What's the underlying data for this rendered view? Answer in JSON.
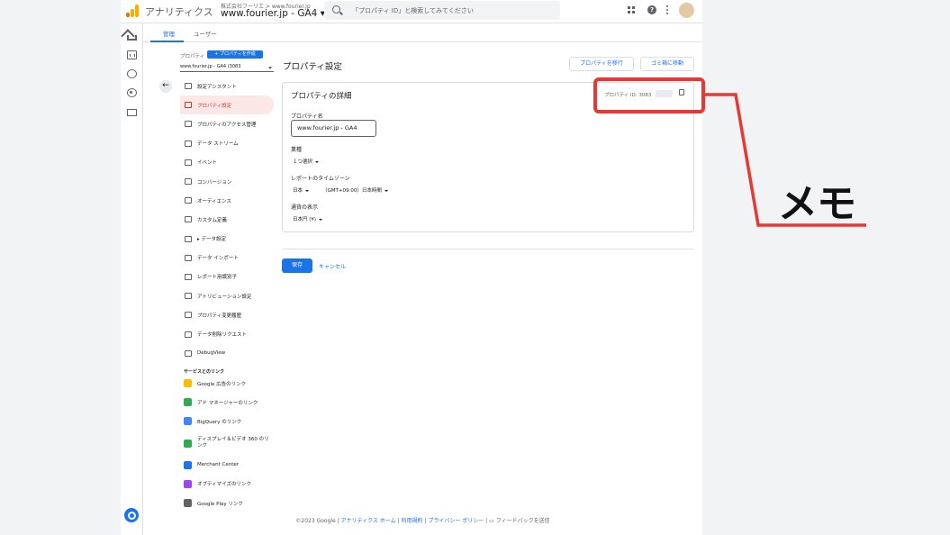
{
  "app": {
    "name": "アナリティクス",
    "org": "株式会社フーリエ > www.fourier.jp",
    "property": "www.fourier.jp - GA4",
    "search_placeholder": "「プロパティ ID」と検索してみてください",
    "help_glyph": "?"
  },
  "tabs": [
    {
      "label": "管理"
    },
    {
      "label": "ユーザー"
    }
  ],
  "sidebar": {
    "property_label": "プロパティ",
    "create_label": "+ プロパティを作成",
    "selected_property": "www.fourier.jp - GA4 (3083",
    "back_glyph": "←",
    "items": [
      {
        "label": "設定アシスタント",
        "icon": "checklist-icon"
      },
      {
        "label": "プロパティ設定",
        "icon": "property-settings-icon"
      },
      {
        "label": "プロパティのアクセス管理",
        "icon": "people-icon"
      },
      {
        "label": "データ ストリーム",
        "icon": "streams-icon"
      },
      {
        "label": "イベント",
        "icon": "touch-icon"
      },
      {
        "label": "コンバージョン",
        "icon": "flag-icon"
      },
      {
        "label": "オーディエンス",
        "icon": "audience-icon"
      },
      {
        "label": "カスタム定義",
        "icon": "shapes-icon"
      },
      {
        "label": "▸ データ設定",
        "icon": "database-icon"
      },
      {
        "label": "データ インポート",
        "icon": "upload-icon"
      },
      {
        "label": "レポート用識別子",
        "icon": "id-icon"
      },
      {
        "label": "アトリビューション設定",
        "icon": "attribution-icon"
      },
      {
        "label": "プロパティ変更履歴",
        "icon": "history-icon"
      },
      {
        "label": "データ削除リクエスト",
        "icon": "dd-icon"
      },
      {
        "label": "DebugView",
        "icon": "debug-icon"
      }
    ],
    "links_section": "サービスとのリンク",
    "links": [
      {
        "label": "Google 広告のリンク",
        "icon": "google-ads-icon",
        "color": "#fbbc04"
      },
      {
        "label": "アド マネージャーのリンク",
        "icon": "ad-manager-icon",
        "color": "#34a853"
      },
      {
        "label": "BigQuery のリンク",
        "icon": "bigquery-icon",
        "color": "#4285f4"
      },
      {
        "label": "ディスプレイ＆ビデオ 360 のリンク",
        "icon": "dv360-icon",
        "color": "#34a853"
      },
      {
        "label": "Merchant Center",
        "icon": "merchant-center-icon",
        "color": "#1a73e8"
      },
      {
        "label": "オプティマイズのリンク",
        "icon": "optimize-icon",
        "color": "#a142f4"
      },
      {
        "label": "Google Play リンク",
        "icon": "google-play-icon",
        "color": "#5f6368"
      }
    ]
  },
  "main": {
    "title": "プロパティ設定",
    "move_property": "プロパティを移行",
    "trash": "ゴミ箱に移動",
    "card_title": "プロパティの詳細",
    "property_id": "プロパティ ID: 3083",
    "name_label": "プロパティ名",
    "name_value": "www.fourier.jp - GA4",
    "industry_label": "業種",
    "industry_value": "１つ選択",
    "timezone_label": "レポートのタイムゾーン",
    "country_value": "日本",
    "timezone_value": "（GMT+09:00）日本時間",
    "currency_label": "通貨の表示",
    "currency_value": "日本円 (¥)",
    "save": "保存",
    "cancel": "キャンセル"
  },
  "footer": {
    "copyright": "©2023 Google |",
    "home": "アナリティクス ホーム",
    "sep": "|",
    "terms": "利用規約",
    "privacy": "プライバシー ポリシー",
    "feedback": "フィードバックを送信"
  },
  "annotation": {
    "memo": "メモ",
    "color": "#e53935"
  }
}
